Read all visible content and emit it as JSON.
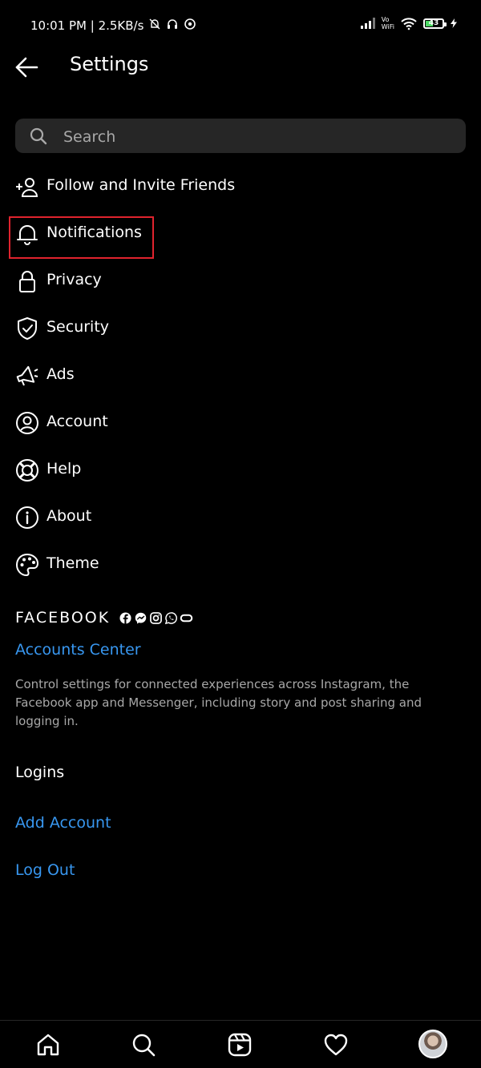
{
  "status_bar": {
    "time_speed": "10:01 PM | 2.5KB/s",
    "vowifi_line1": "Vo",
    "vowifi_line2": "WiFi",
    "battery": "43",
    "battery_level": 0.43
  },
  "header": {
    "title": "Settings"
  },
  "search": {
    "placeholder": "Search"
  },
  "menu": {
    "items": [
      {
        "label": "Follow and Invite Friends",
        "icon": "add-person-icon"
      },
      {
        "label": "Notifications",
        "icon": "bell-icon"
      },
      {
        "label": "Privacy",
        "icon": "lock-icon"
      },
      {
        "label": "Security",
        "icon": "shield-check-icon"
      },
      {
        "label": "Ads",
        "icon": "megaphone-icon"
      },
      {
        "label": "Account",
        "icon": "user-circle-icon"
      },
      {
        "label": "Help",
        "icon": "lifebuoy-icon"
      },
      {
        "label": "About",
        "icon": "info-icon"
      },
      {
        "label": "Theme",
        "icon": "palette-icon"
      }
    ]
  },
  "facebook": {
    "label": "FACEBOOK",
    "icons": [
      "facebook-icon",
      "messenger-icon",
      "instagram-icon",
      "whatsapp-icon",
      "oculus-icon"
    ],
    "accounts_center": "Accounts Center",
    "description": "Control settings for connected experiences across Instagram, the Facebook app and Messenger, including story and post sharing and logging in."
  },
  "logins": {
    "heading": "Logins",
    "add_account": "Add Account",
    "log_out": "Log Out"
  },
  "bottom_nav": {
    "items": [
      "home-icon",
      "search-icon",
      "reels-icon",
      "heart-icon",
      "profile-avatar"
    ]
  },
  "colors": {
    "background": "#000000",
    "link": "#3897f0",
    "highlight": "#e0232e",
    "search_bg": "#262626",
    "muted_text": "#a8a8a8"
  }
}
